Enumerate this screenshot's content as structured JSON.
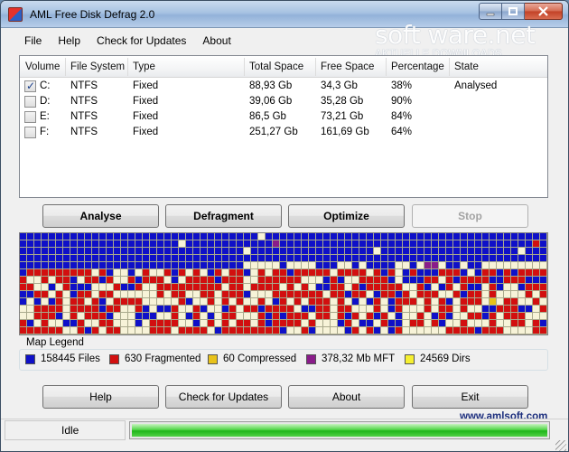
{
  "window": {
    "title": "AML Free Disk Defrag 2.0",
    "icons": {
      "app": "app-logo-icon",
      "minimize": "minimize-icon",
      "maximize": "maximize-icon",
      "close": "close-icon"
    }
  },
  "menu": [
    "File",
    "Help",
    "Check for Updates",
    "About"
  ],
  "watermark": {
    "main": "soft ware.net",
    "sub": "AKTUELLE DOWNLOADS"
  },
  "drives": {
    "columns": [
      "Volume",
      "File System",
      "Type",
      "Total Space",
      "Free Space",
      "Percentage",
      "State"
    ],
    "rows": [
      {
        "checked": true,
        "volume": "C:",
        "fs": "NTFS",
        "type": "Fixed",
        "total": "88,93 Gb",
        "free": "34,3 Gb",
        "pct": "38%",
        "state": "Analysed"
      },
      {
        "checked": false,
        "volume": "D:",
        "fs": "NTFS",
        "type": "Fixed",
        "total": "39,06 Gb",
        "free": "35,28 Gb",
        "pct": "90%",
        "state": ""
      },
      {
        "checked": false,
        "volume": "E:",
        "fs": "NTFS",
        "type": "Fixed",
        "total": "86,5 Gb",
        "free": "73,21 Gb",
        "pct": "84%",
        "state": ""
      },
      {
        "checked": false,
        "volume": "F:",
        "fs": "NTFS",
        "type": "Fixed",
        "total": "251,27 Gb",
        "free": "161,69 Gb",
        "pct": "64%",
        "state": ""
      }
    ]
  },
  "actions": {
    "analyse": "Analyse",
    "defragment": "Defragment",
    "optimize": "Optimize",
    "stop": "Stop"
  },
  "map": {
    "colors": {
      "files": "#0f10c8",
      "fragmented": "#d20f0f",
      "compressed": "#e8c21a",
      "mft": "#8a1c8a",
      "dirs": "#f6f030",
      "free": "#f7f3d8"
    }
  },
  "legend": {
    "title": "Map Legend",
    "items": [
      {
        "label": "158445 Files",
        "color": "#0f10c8"
      },
      {
        "label": "630 Fragmented",
        "color": "#d20f0f"
      },
      {
        "label": "60 Compressed",
        "color": "#e8c21a"
      },
      {
        "label": "378,32 Mb MFT",
        "color": "#8a1c8a"
      },
      {
        "label": "24569 Dirs",
        "color": "#f6f030"
      }
    ]
  },
  "bottom_buttons": {
    "help": "Help",
    "updates": "Check for Updates",
    "about": "About",
    "exit": "Exit"
  },
  "status": {
    "text": "Idle",
    "site": "www.amlsoft.com",
    "progress_percent": 100
  }
}
